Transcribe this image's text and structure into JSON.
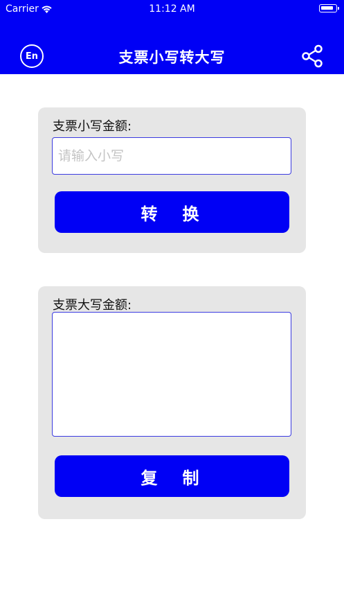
{
  "status_bar": {
    "carrier": "Carrier",
    "time": "11:12 AM"
  },
  "nav": {
    "title": "支票小写转大写",
    "lang_label": "En",
    "share_icon": "share-icon"
  },
  "converter": {
    "input_label": "支票小写金额:",
    "input_placeholder": "请输入小写",
    "input_value": "",
    "convert_label": "转　换"
  },
  "result": {
    "output_label": "支票大写金额:",
    "output_value": "",
    "copy_label": "复　制"
  },
  "colors": {
    "primary": "#0000f5",
    "card_bg": "#e6e6e6",
    "field_border": "#3a3ae0",
    "placeholder": "#c4c4c4"
  }
}
